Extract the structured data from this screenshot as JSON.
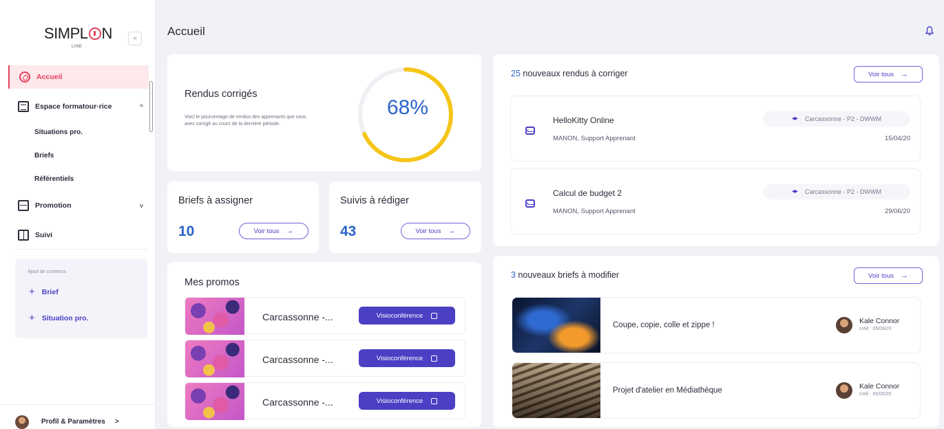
{
  "sidebar": {
    "brand": "SIMPL",
    "brand_end": "N",
    "brand_sub": "LINE",
    "collapse_label": "«",
    "nav": [
      {
        "label": "Accueil",
        "icon": "compass-icon",
        "active": true
      },
      {
        "label": "Espace formatour·rice",
        "icon": "document-icon",
        "chevron": "^"
      },
      {
        "label": "Promotion",
        "icon": "promotion-icon",
        "chevron": "v"
      },
      {
        "label": "Suivi",
        "icon": "suivi-icon"
      }
    ],
    "sub_items": [
      "Situations pro.",
      "Briefs",
      "Référentiels"
    ],
    "add_box": {
      "title": "Ajout de contenus",
      "items": [
        "Brief",
        "Situation pro."
      ],
      "plus": "+"
    },
    "profile": {
      "label": "Profil & Paramètres",
      "arrow": ">"
    }
  },
  "header": {
    "title": "Accueil"
  },
  "rendus_corriges": {
    "title": "Rendus corrigés",
    "description": "Voici le pourcentage de rendus des apprenants que vous avez corrigé au cours de la dernière période.",
    "percent_label": "68%",
    "percent": 0.68,
    "color": "#f5c518"
  },
  "briefs_assigner": {
    "title": "Briefs à assigner",
    "count": "10",
    "button": "Voir tous",
    "arrow": "→"
  },
  "suivis_rediger": {
    "title": "Suivis à rédiger",
    "count": "43",
    "button": "Voir tous",
    "arrow": "→"
  },
  "mes_promos": {
    "title": "Mes promos",
    "rows": [
      {
        "name": "Carcassonne -...",
        "button": "Visioconférence"
      },
      {
        "name": "Carcassonne -...",
        "button": "Visioconférence"
      },
      {
        "name": "Carcassonne -...",
        "button": "Visioconférence"
      }
    ]
  },
  "rendus": {
    "count": "25",
    "title": " nouveaux rendus à corriger",
    "button": "Voir tous",
    "arrow": "→",
    "items": [
      {
        "title": "HelloKitty Online",
        "sub": "MANON, Support Apprenant",
        "tag": "Carcassonne - P2 - DWWM",
        "date": "15/04/20"
      },
      {
        "title": "Calcul de budget 2",
        "sub": "MANON, Support Apprenant",
        "tag": "Carcassonne - P2 - DWWM",
        "date": "29/06/20"
      }
    ]
  },
  "briefs": {
    "count": "3",
    "title": " nouveaux briefs à modifier",
    "button": "Voir tous",
    "arrow": "→",
    "items": [
      {
        "title": "Coupe, copie, colle et zippe !",
        "author": "Kale Connor",
        "date": "créé : 05/06/20"
      },
      {
        "title": "Projet d'atelier en Médiathèque",
        "author": "Kale Connor",
        "date": "créé : 05/06/20"
      }
    ]
  },
  "colors": {
    "accent": "#4b3fc4",
    "brand": "#e43f5a",
    "number": "#2a64c8"
  }
}
